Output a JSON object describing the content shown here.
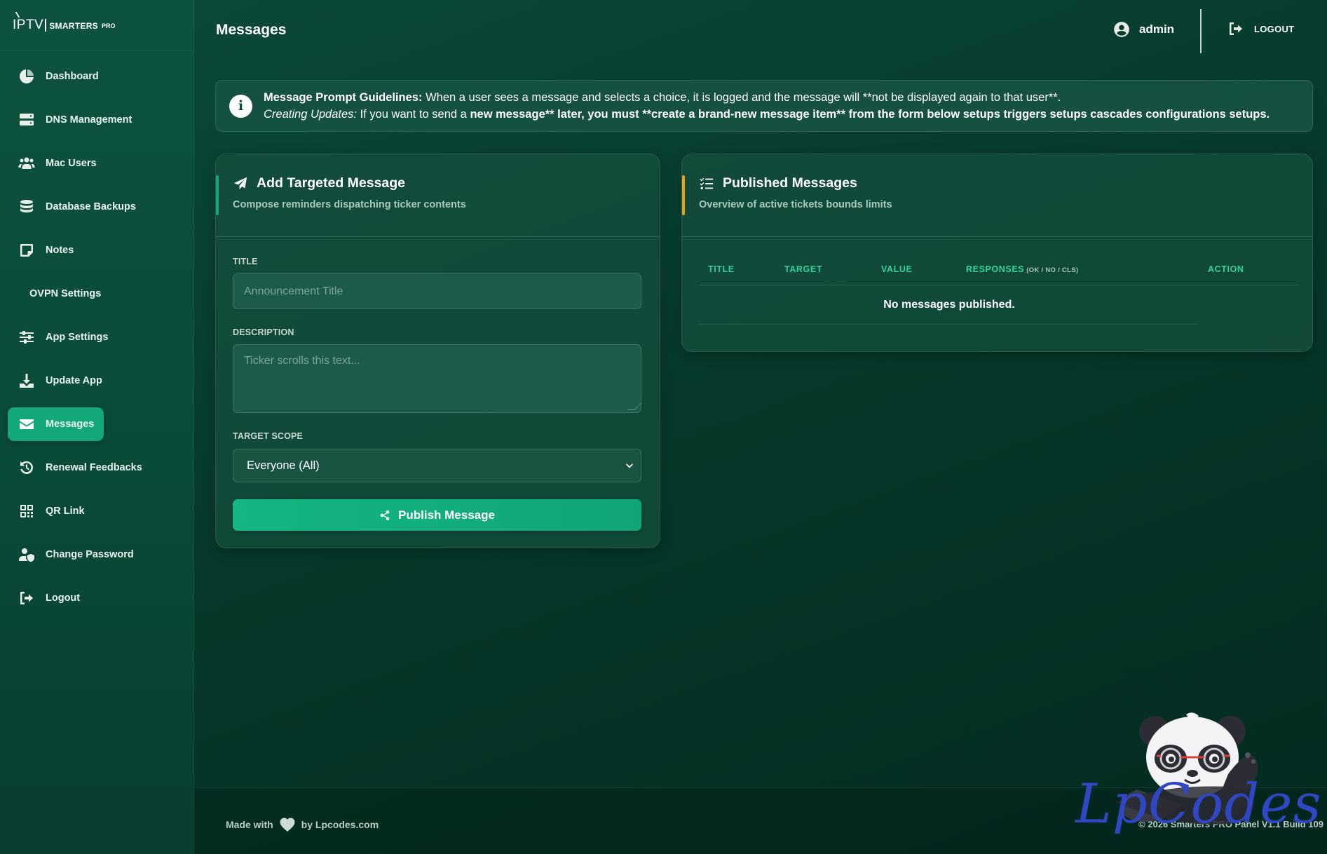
{
  "brand": {
    "iptv": "IPTV",
    "smarters": "SMARTERS",
    "pro": "PRO"
  },
  "sidebar": {
    "items": [
      {
        "label": "Dashboard",
        "icon": "pie-chart-icon"
      },
      {
        "label": "DNS Management",
        "icon": "server-icon"
      },
      {
        "label": "Mac Users",
        "icon": "users-icon"
      },
      {
        "label": "Database Backups",
        "icon": "database-icon"
      },
      {
        "label": "Notes",
        "icon": "note-icon"
      },
      {
        "label": "OVPN Settings",
        "icon": ""
      },
      {
        "label": "App Settings",
        "icon": "sliders-icon"
      },
      {
        "label": "Update App",
        "icon": "download-icon"
      },
      {
        "label": "Messages",
        "icon": "envelope-icon"
      },
      {
        "label": "Renewal Feedbacks",
        "icon": "history-icon"
      },
      {
        "label": "QR Link",
        "icon": "qrcode-icon"
      },
      {
        "label": "Change Password",
        "icon": "user-shield-icon"
      },
      {
        "label": "Logout",
        "icon": "sign-out-icon"
      }
    ],
    "active": "Messages"
  },
  "header": {
    "title": "Messages",
    "user": "admin",
    "logout": "LOGOUT"
  },
  "banner": {
    "title": "Message Prompt Guidelines:",
    "line1": " When a user sees a message and selects a choice, it is logged and the message will **not be displayed again to that user**.",
    "line2_label": "Creating Updates:",
    "line2_pre": " If you want to send a ",
    "line2_bold": "new message** later, you must **create a brand-new message item** from the form below setups triggers setups cascades configurations setups."
  },
  "add_card": {
    "title": "Add Targeted Message",
    "subtitle": "Compose reminders dispatching ticker contents",
    "title_label": "TITLE",
    "title_placeholder": "Announcement Title",
    "description_label": "DESCRIPTION",
    "description_placeholder": "Ticker scrolls this text...",
    "scope_label": "TARGET SCOPE",
    "scope_value": "Everyone (All)",
    "publish_label": "Publish Message"
  },
  "published_card": {
    "title": "Published Messages",
    "subtitle": "Overview of active tickets bounds limits",
    "columns": {
      "title": "TITLE",
      "target": "TARGET",
      "value": "VALUE",
      "responses": "RESPONSES",
      "responses_hint": "(OK / NO / CLS)",
      "action": "ACTION"
    },
    "empty": "No messages published."
  },
  "footer": {
    "made_with": "Made with",
    "by": "by Lpcodes.com",
    "copyright": "© 2026 Smarters PRO Panel V1.1 Build 109"
  },
  "watermark": {
    "text": "LpCodes"
  },
  "colors": {
    "accent_green": "#13a879",
    "accent_orange": "#e8a317",
    "table_header": "#34d39a"
  }
}
